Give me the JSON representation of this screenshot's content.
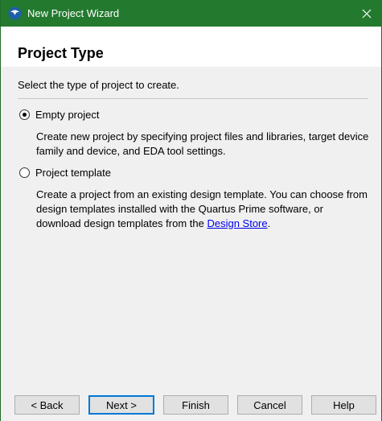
{
  "window": {
    "title": "New Project Wizard",
    "close_glyph": "✕",
    "title_icon": "quartus-logo-icon",
    "titlebar_color": "#237a2f"
  },
  "page": {
    "title": "Project Type",
    "prompt": "Select the type of project to create."
  },
  "options": [
    {
      "label": "Empty project",
      "selected": true,
      "description": "Create new project by specifying project files and libraries, target device family and device, and EDA tool settings."
    },
    {
      "label": "Project template",
      "selected": false,
      "description_before_link": "Create a project from an existing design template. You can choose from design templates installed with the Quartus Prime software, or download design templates from the ",
      "link_text": "Design Store",
      "description_after_link": "."
    }
  ],
  "buttons": {
    "back": "< Back",
    "next": "Next >",
    "finish": "Finish",
    "cancel": "Cancel",
    "help": "Help"
  }
}
